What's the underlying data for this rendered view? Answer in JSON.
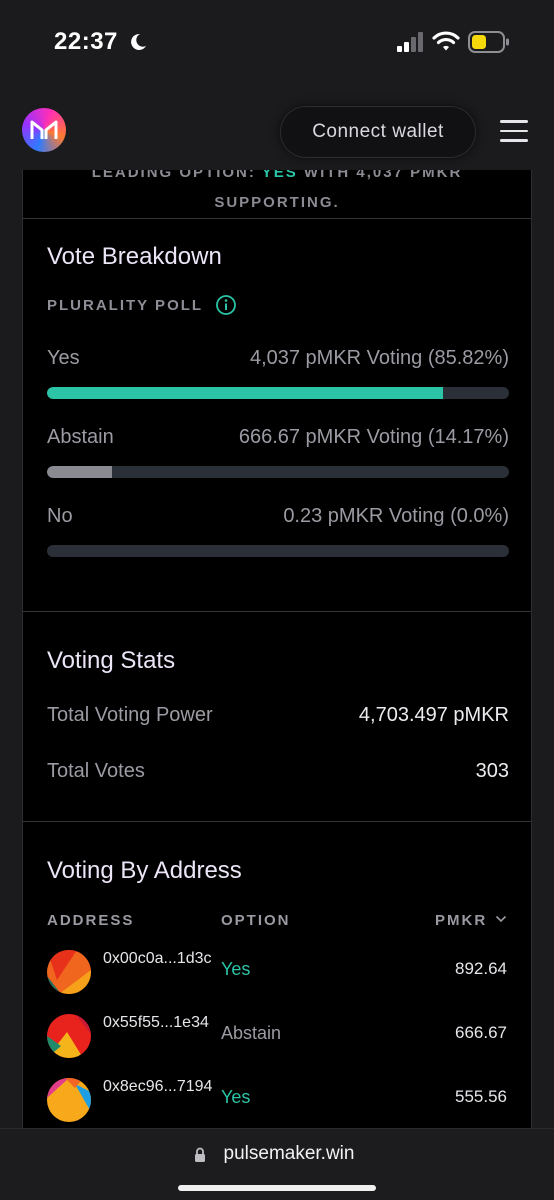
{
  "status_bar": {
    "time": "22:37",
    "moon_icon": "moon-icon",
    "signal_icon": "signal-icon",
    "wifi_icon": "wifi-icon",
    "battery_icon": "battery-icon",
    "battery_color": "#f5d90a"
  },
  "header": {
    "logo_icon": "maker-logo-icon",
    "connect_label": "Connect wallet",
    "menu_icon": "hamburger-menu-icon"
  },
  "leading_banner": {
    "line1_prefix": "LEADING OPTION: ",
    "line1_option": "YES",
    "line1_suffix": " WITH 4,037 PMKR",
    "line2": "SUPPORTING."
  },
  "vote_breakdown": {
    "title": "Vote Breakdown",
    "poll_type": "PLURALITY POLL",
    "options": [
      {
        "name": "Yes",
        "value": "4,037 pMKR Voting (85.82%)",
        "percent": 85.82,
        "color": "#2bc4a6"
      },
      {
        "name": "Abstain",
        "value": "666.67 pMKR Voting (14.17%)",
        "percent": 14.17,
        "color": "#8a8a92"
      },
      {
        "name": "No",
        "value": "0.23 pMKR Voting (0.0%)",
        "percent": 0.0,
        "color": "#8a8a92"
      }
    ]
  },
  "voting_stats": {
    "title": "Voting Stats",
    "total_power_label": "Total Voting Power",
    "total_power_value": "4,703.497 pMKR",
    "total_votes_label": "Total Votes",
    "total_votes_value": "303"
  },
  "voting_by_address": {
    "title": "Voting By Address",
    "columns": {
      "address": "ADDRESS",
      "option": "OPTION",
      "amount": "PMKR"
    },
    "rows": [
      {
        "address": "0x00c0a...1d3c",
        "option": "Yes",
        "option_color": "#2bc4a6",
        "amount": "892.64"
      },
      {
        "address": "0x55f55...1e34",
        "option": "Abstain",
        "option_color": "#9b9ba3",
        "amount": "666.67"
      },
      {
        "address": "0x8ec96...7194",
        "option": "Yes",
        "option_color": "#2bc4a6",
        "amount": "555.56"
      }
    ]
  },
  "browser": {
    "url": "pulsemaker.win",
    "lock_icon": "lock-icon"
  },
  "colors": {
    "accent": "#2bc4a6",
    "background": "#000000"
  }
}
